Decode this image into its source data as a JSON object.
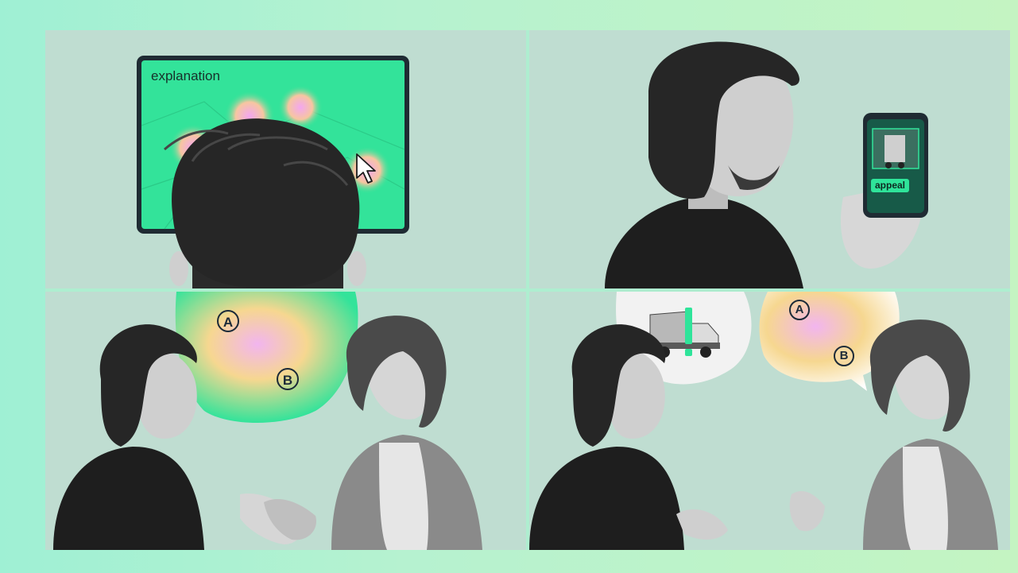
{
  "panels": [
    {
      "id": "panel-explanation",
      "screen_label": "explanation"
    },
    {
      "id": "panel-appeal",
      "phone_label": "appeal"
    },
    {
      "id": "panel-agreement",
      "map_markers": [
        "A",
        "B"
      ]
    },
    {
      "id": "panel-dispute",
      "map_markers": [
        "A",
        "B"
      ]
    }
  ],
  "colors": {
    "background": "#b6f2d0",
    "panel": "#bfddd1",
    "accent_green": "#2fe49a",
    "heat_pink": "#f2a3e6",
    "heat_yellow": "#f5d98a"
  },
  "icons": [
    "pointer-cursor-icon",
    "truck-icon",
    "exclamation-icon",
    "handshake-icon"
  ]
}
